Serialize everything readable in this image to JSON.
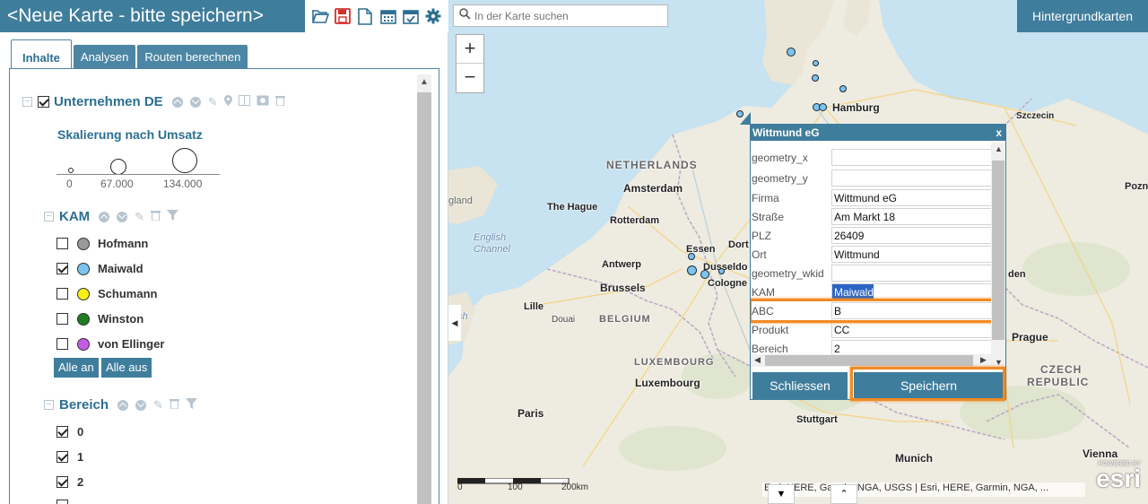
{
  "app": {
    "title": "<Neue Karte - bitte speichern>",
    "toolbar_icons": [
      "folder-open-icon",
      "save-icon",
      "new-file-icon",
      "calendar-icon",
      "calendar-check-icon",
      "gear-icon"
    ]
  },
  "tabs": [
    {
      "label": "Inhalte",
      "active": true
    },
    {
      "label": "Analysen",
      "active": false
    },
    {
      "label": "Routen berechnen",
      "active": false
    }
  ],
  "layer": {
    "title": "Unternehmen DE",
    "checked": true,
    "legend_title": "Skalierung nach Umsatz",
    "scale_labels": [
      "0",
      "67.000",
      "134.000"
    ]
  },
  "kam": {
    "title": "KAM",
    "items": [
      {
        "label": "Hofmann",
        "checked": false,
        "color": "#9a9a9a"
      },
      {
        "label": "Maiwald",
        "checked": true,
        "color": "#7cc3ee"
      },
      {
        "label": "Schumann",
        "checked": false,
        "color": "#f7f016"
      },
      {
        "label": "Winston",
        "checked": false,
        "color": "#1e7d1e"
      },
      {
        "label": "von Ellinger",
        "checked": false,
        "color": "#c45ce8"
      }
    ],
    "btn_all_on": "Alle an",
    "btn_all_off": "Alle aus"
  },
  "bereich": {
    "title": "Bereich",
    "items": [
      {
        "label": "0",
        "checked": true
      },
      {
        "label": "1",
        "checked": true
      },
      {
        "label": "2",
        "checked": true
      }
    ]
  },
  "map": {
    "search_placeholder": "In der Karte suchen",
    "basemap_label": "Hintergrundkarten",
    "zoom_in": "+",
    "zoom_out": "−",
    "labels": {
      "hamburg": "Hamburg",
      "szczecin": "Szczecin",
      "netherlands": "NETHERLANDS",
      "amsterdam": "Amsterdam",
      "the_hague": "The Hague",
      "rotterdam": "Rotterdam",
      "england": "gland",
      "english_channel_1": "English",
      "english_channel_2": "Channel",
      "essen": "Essen",
      "dort": "Dort",
      "dusseldorf": "Dusseldo",
      "cologne": "Cologne",
      "antwerp": "Antwerp",
      "brussels": "Brussels",
      "lille": "Lille",
      "douai": "Douai",
      "belgium": "BELGIUM",
      "luxembourg_country": "LUXEMBOURG",
      "luxembourg": "Luxembourg",
      "paris": "Paris",
      "stuttgart": "Stuttgart",
      "munich": "Munich",
      "prague": "Prague",
      "czech_1": "CZECH",
      "czech_2": "REPUBLIC",
      "vienna": "Vienna",
      "poznan": "Pozna",
      "dresden_part": "den",
      "sh": "sh"
    },
    "scalebar": {
      "l0": "0",
      "l1": "100",
      "l2": "200km"
    },
    "attribution": "Esri, HERE, Garmin, NGA, USGS | Esri, HERE, Garmin, NGA, ...",
    "esri_powered": "POWERED BY",
    "esri_logo": "esri"
  },
  "popup": {
    "title": "Wittmund eG",
    "close": "x",
    "fields": [
      {
        "key": "geometry_x",
        "value": ""
      },
      {
        "key": "geometry_y",
        "value": ""
      },
      {
        "key": "Firma",
        "value": "Wittmund eG"
      },
      {
        "key": "Straße",
        "value": "Am Markt 18"
      },
      {
        "key": "PLZ",
        "value": "26409"
      },
      {
        "key": "Ort",
        "value": "Wittmund"
      },
      {
        "key": "geometry_wkid",
        "value": ""
      },
      {
        "key": "KAM",
        "value": "Maiwald"
      },
      {
        "key": "ABC",
        "value": "B"
      },
      {
        "key": "Produkt",
        "value": "CC"
      },
      {
        "key": "Bereich",
        "value": "2"
      }
    ],
    "btn_close": "Schliessen",
    "btn_save": "Speichern"
  },
  "colors": {
    "accent": "#3f7d9c",
    "highlight": "#f08a24",
    "poi_fill": "#7cc3ee"
  }
}
